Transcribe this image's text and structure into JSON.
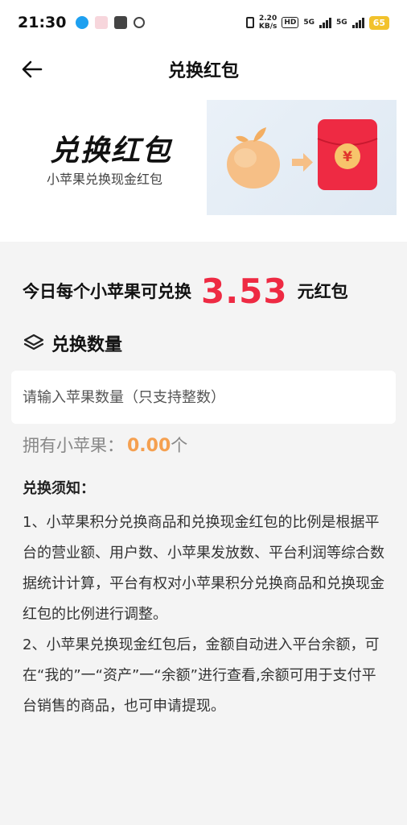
{
  "status_bar": {
    "time": "21:30",
    "net_speed_value": "2.20",
    "net_speed_unit": "KB/s",
    "hd_tag": "HD",
    "net_type_1": "5G",
    "net_type_2": "5G",
    "battery": "65"
  },
  "nav": {
    "title": "兑换红包"
  },
  "banner": {
    "title": "兑换红包",
    "subtitle": "小苹果兑换现金红包",
    "red_packet_symbol": "¥"
  },
  "rate": {
    "prefix": "今日每个小苹果可兑换",
    "value": "3.53",
    "suffix": "元红包"
  },
  "section": {
    "label": "兑换数量"
  },
  "input": {
    "placeholder": "请输入苹果数量（只支持整数）",
    "value": ""
  },
  "owned": {
    "label": "拥有小苹果：",
    "value": "0.00",
    "unit": "个"
  },
  "notice": {
    "title": "兑换须知：",
    "items": [
      "1、小苹果积分兑换商品和兑换现金红包的比例是根据平台的营业额、用户数、小苹果发放数、平台利润等综合数据统计计算，平台有权对小苹果积分兑换商品和兑换现金红包的比例进行调整。",
      "2、小苹果兑换现金红包后，金额自动进入平台余额，可在“我的”一“资产”一“余额”进行查看,余额可用于支付平台销售的商品，也可申请提现。"
    ]
  },
  "colors": {
    "accent_red": "#ee2a43",
    "owned_orange": "#f5a050",
    "background": "#f4f4f4"
  },
  "icons": [
    "back-arrow-icon",
    "layers-icon",
    "apple-icon",
    "arrow-right-icon",
    "red-packet-icon"
  ]
}
